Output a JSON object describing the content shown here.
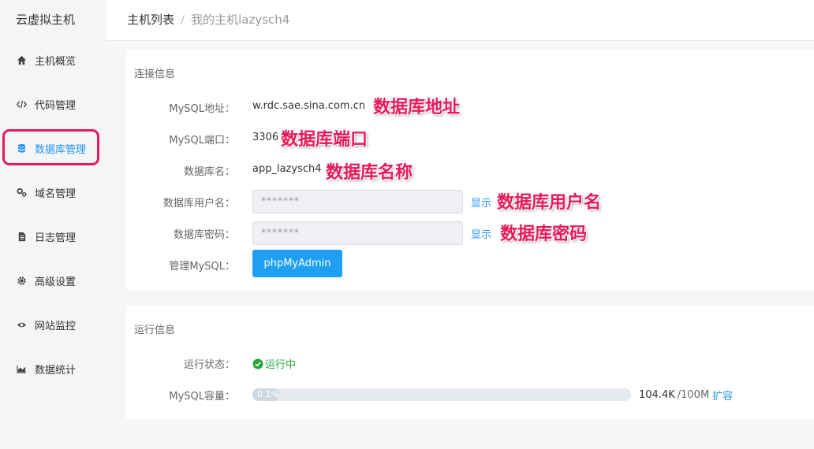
{
  "sidebar": {
    "title": "云虚拟主机",
    "items": [
      {
        "label": "主机概览",
        "icon": "home-icon"
      },
      {
        "label": "代码管理",
        "icon": "code-icon"
      },
      {
        "label": "数据库管理",
        "icon": "database-icon",
        "active": true
      },
      {
        "label": "域名管理",
        "icon": "gears-icon"
      },
      {
        "label": "日志管理",
        "icon": "file-icon"
      },
      {
        "label": "高级设置",
        "icon": "gear-icon"
      },
      {
        "label": "网站监控",
        "icon": "eye-icon"
      },
      {
        "label": "数据统计",
        "icon": "area-chart-icon"
      }
    ]
  },
  "breadcrumb": {
    "root": "主机列表",
    "separator": "/",
    "current": "我的主机lazysch4"
  },
  "connection": {
    "section_title": "连接信息",
    "mysql_address_label": "MySQL地址：",
    "mysql_address_value": "w.rdc.sae.sina.com.cn",
    "mysql_port_label": "MySQL端口：",
    "mysql_port_value": "3306",
    "db_name_label": "数据库名：",
    "db_name_value": "app_lazysch4",
    "db_user_label": "数据库用户名：",
    "db_user_value": "*******",
    "db_password_label": "数据库密码：",
    "db_password_value": "*******",
    "show_label": "显示",
    "manage_label": "管理MySQL：",
    "manage_button": "phpMyAdmin"
  },
  "annotations": {
    "address": "数据库地址",
    "port": "数据库端口",
    "name": "数据库名称",
    "user": "数据库用户名",
    "password": "数据库密码"
  },
  "runtime": {
    "section_title": "运行信息",
    "status_label": "运行状态：",
    "status_value": "运行中",
    "capacity_label": "MySQL容量：",
    "capacity_percent_text": "0.1%",
    "capacity_fraction": 0.001,
    "used": "104.4K",
    "total": "/100M",
    "expand_label": "扩容"
  },
  "colors": {
    "accent": "#2196f3",
    "button": "#1e9ff2",
    "annotation": "#e8195a",
    "success": "#22a83a"
  }
}
